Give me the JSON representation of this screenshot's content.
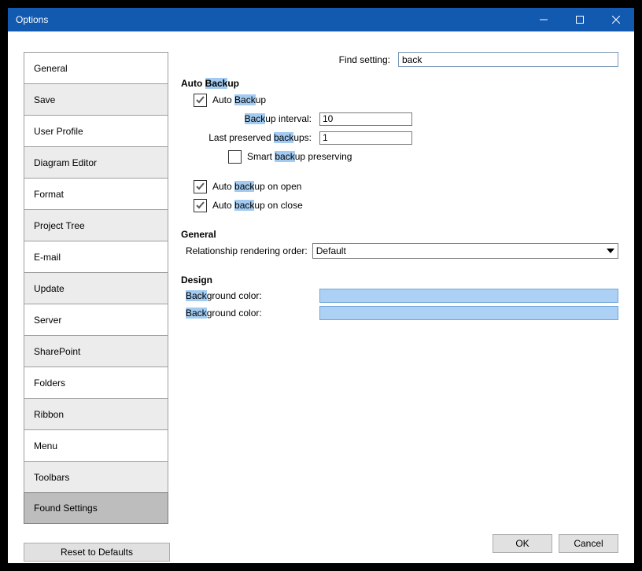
{
  "window": {
    "title": "Options"
  },
  "sidebar": {
    "items": [
      {
        "label": "General"
      },
      {
        "label": "Save"
      },
      {
        "label": "User Profile"
      },
      {
        "label": "Diagram Editor"
      },
      {
        "label": "Format"
      },
      {
        "label": "Project Tree"
      },
      {
        "label": "E-mail"
      },
      {
        "label": "Update"
      },
      {
        "label": "Server"
      },
      {
        "label": "SharePoint"
      },
      {
        "label": "Folders"
      },
      {
        "label": "Ribbon"
      },
      {
        "label": "Menu"
      },
      {
        "label": "Toolbars"
      },
      {
        "label": "Found Settings"
      }
    ]
  },
  "buttons": {
    "reset": "Reset to Defaults",
    "ok": "OK",
    "cancel": "Cancel"
  },
  "find": {
    "label": "Find setting:",
    "value": "back"
  },
  "autoBackup": {
    "heading_pre": "Auto ",
    "heading_hl": "Back",
    "heading_post": "up",
    "cb1_pre": "Auto ",
    "cb1_hl": "Back",
    "cb1_post": "up",
    "interval_hl": "Back",
    "interval_post": "up interval:",
    "interval_value": "10",
    "last_pre": "Last preserved ",
    "last_hl": "back",
    "last_post": "ups:",
    "last_value": "1",
    "smart_pre": "Smart ",
    "smart_hl": "back",
    "smart_post": "up preserving",
    "open_pre": "Auto ",
    "open_hl": "back",
    "open_post": "up on open",
    "close_pre": "Auto ",
    "close_hl": "back",
    "close_post": "up on close"
  },
  "general": {
    "heading": "General",
    "rel_label": "Relationship rendering order:",
    "rel_value": "Default"
  },
  "design": {
    "heading": "Design",
    "bg1_hl": "Back",
    "bg1_post": "ground color:",
    "bg1_color": "#ADD1F4",
    "bg2_hl": "Back",
    "bg2_post": "ground color:",
    "bg2_color": "#ADD1F4"
  }
}
